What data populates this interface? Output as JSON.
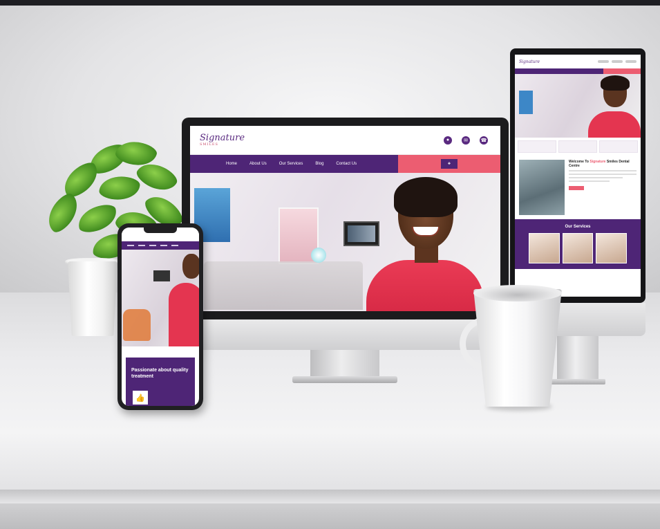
{
  "scene": {
    "accent_purple": "#4e2576",
    "accent_coral": "#ec5d71"
  },
  "desktop_site": {
    "logo_script": "Signature",
    "logo_tag": "SMILES",
    "nav_items": [
      "Home",
      "About Us",
      "Our Services",
      "Blog",
      "Contact Us"
    ]
  },
  "phone_site": {
    "card_subtitle": "",
    "card_title": "Passionate about quality treatment"
  },
  "tall_site": {
    "welcome_title_prefix": "Welcome To",
    "welcome_title_highlight": "Signature",
    "welcome_title_suffix": "Smiles Dental Centre",
    "services_title": "Our Services"
  }
}
